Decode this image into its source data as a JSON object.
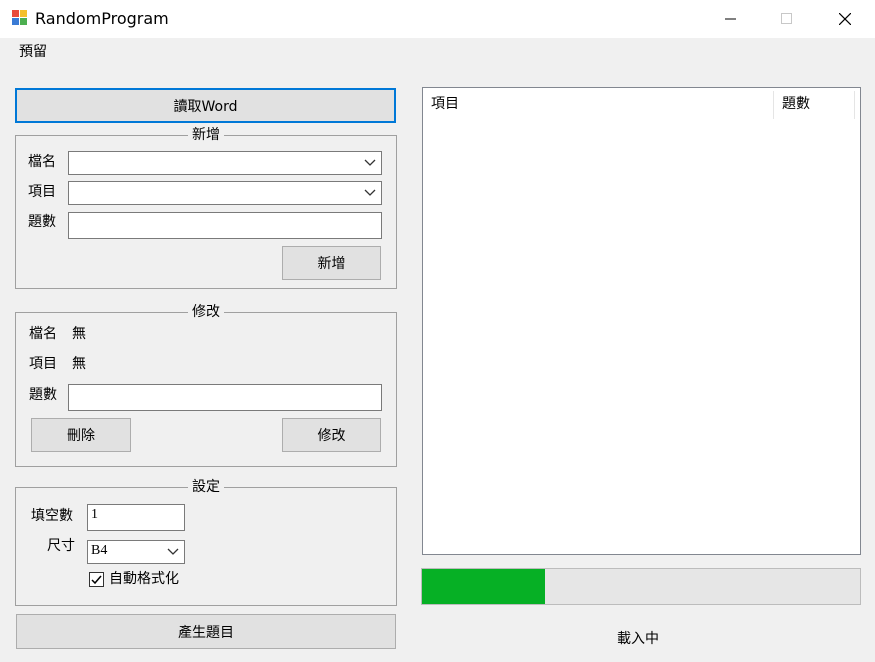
{
  "window": {
    "title": "RandomProgram",
    "minimize_glyph": "—",
    "maximize_glyph": "☐",
    "close_glyph": "✕",
    "app_icon": "app-icon-four-squares"
  },
  "menu": {
    "items": [
      {
        "label": "預留"
      }
    ]
  },
  "read_word_button": {
    "label": "讀取Word"
  },
  "add_group": {
    "title": "新增",
    "file_label": "檔名",
    "file_value": "",
    "item_label": "項目",
    "item_value": "",
    "count_label": "題數",
    "count_value": "",
    "add_button": "新增"
  },
  "edit_group": {
    "title": "修改",
    "file_label": "檔名",
    "file_value": "無",
    "item_label": "項目",
    "item_value": "無",
    "count_label": "題數",
    "count_value": "",
    "delete_button": "刪除",
    "edit_button": "修改"
  },
  "settings_group": {
    "title": "設定",
    "blanks_label": "填空數",
    "blanks_value": "1",
    "size_label": "尺寸",
    "size_value": "B4",
    "autoformat_label": "自動格式化",
    "autoformat_checked": true
  },
  "generate_button": {
    "label": "產生題目"
  },
  "list_view": {
    "columns": [
      {
        "label": "項目"
      },
      {
        "label": "題數"
      }
    ],
    "rows": []
  },
  "progress": {
    "value_percent": 28
  },
  "status": {
    "text": "載入中"
  },
  "colors": {
    "focus_accent": "#0078d7",
    "progress_fill": "#06b025"
  }
}
